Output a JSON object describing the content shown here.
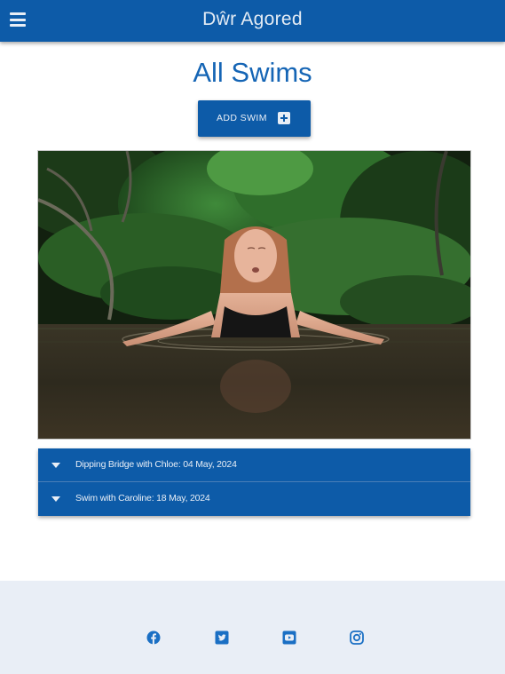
{
  "header": {
    "brand": "Dŵr Agored",
    "menu_icon": "bars-icon"
  },
  "page": {
    "title": "All Swims"
  },
  "add_button": {
    "label": "ADD SWIM",
    "icon": "plus-square-icon"
  },
  "photo": {
    "alt": "Woman swimming in a river"
  },
  "swims": [
    {
      "name": "Dipping Bridge with Chloe",
      "date": ": 04 May, 2024"
    },
    {
      "name": "Swim with Caroline",
      "date": ": 18 May, 2024"
    }
  ],
  "footer": {
    "social": [
      "facebook-icon",
      "twitter-icon",
      "youtube-icon",
      "instagram-icon"
    ]
  },
  "colors": {
    "primary": "#0d5ba8",
    "title": "#1565b5",
    "footer_bg": "#e9eef6",
    "icon": "#1a6fc4"
  }
}
